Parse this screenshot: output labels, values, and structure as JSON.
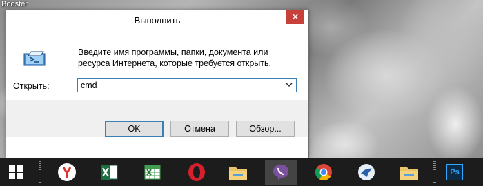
{
  "desktop": {
    "label": "Booster"
  },
  "dialog": {
    "title": "Выполнить",
    "close_glyph": "✕",
    "description": "Введите имя программы, папки, документа или ресурса Интернета, которые требуется открыть.",
    "open_label": "Открыть:",
    "open_label_accesskey": "О",
    "open_label_rest": "ткрыть:",
    "command_value": "cmd",
    "buttons": {
      "ok": "OK",
      "cancel": "Отмена",
      "browse": "Обзор..."
    }
  },
  "taskbar": {
    "items": [
      {
        "name": "start",
        "icon": "windows-icon"
      },
      {
        "name": "yandex-browser",
        "icon": "yandex-icon"
      },
      {
        "name": "excel",
        "icon": "excel-icon"
      },
      {
        "name": "excel-2",
        "icon": "excel-alt-icon"
      },
      {
        "name": "opera",
        "icon": "opera-icon"
      },
      {
        "name": "file-explorer",
        "icon": "folder-icon"
      },
      {
        "name": "viber",
        "icon": "viber-icon",
        "active": true
      },
      {
        "name": "chrome",
        "icon": "chrome-icon"
      },
      {
        "name": "app-bird",
        "icon": "bird-icon"
      },
      {
        "name": "file-explorer-2",
        "icon": "folder-icon"
      },
      {
        "name": "photoshop",
        "icon": "photoshop-icon",
        "label": "Ps"
      }
    ]
  },
  "colors": {
    "close": "#c7413a",
    "focus": "#3c7fb1",
    "taskbar": "#1c1c1c"
  }
}
